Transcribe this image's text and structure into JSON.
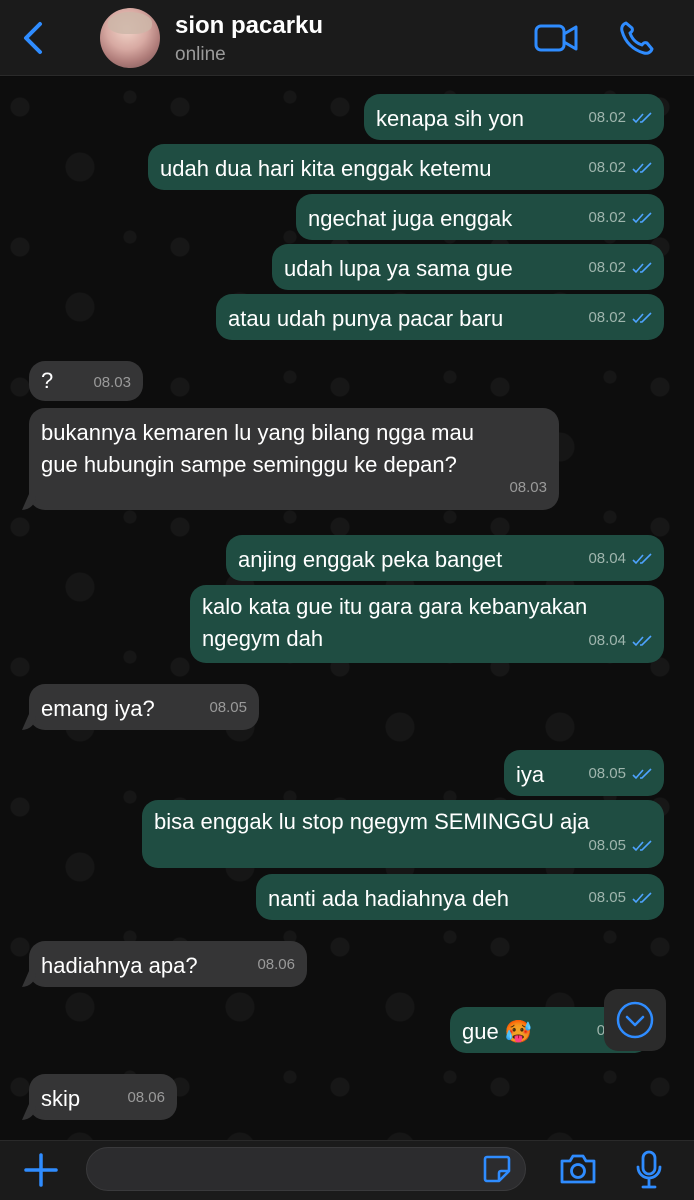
{
  "header": {
    "contact_name": "sion pacarku",
    "status": "online",
    "icons": [
      "chevron-left-icon",
      "video-camera-icon",
      "phone-icon"
    ]
  },
  "messages": [
    {
      "dir": "out",
      "text": "kenapa sih yon",
      "time": "08.02"
    },
    {
      "dir": "out",
      "text": "udah dua hari kita enggak ketemu",
      "time": "08.02"
    },
    {
      "dir": "out",
      "text": "ngechat juga enggak",
      "time": "08.02"
    },
    {
      "dir": "out",
      "text": "udah lupa ya sama gue",
      "time": "08.02"
    },
    {
      "dir": "out",
      "text": "atau udah punya pacar baru",
      "time": "08.02"
    },
    {
      "dir": "in",
      "text": "?",
      "time": "08.03"
    },
    {
      "dir": "in",
      "text_line1": "bukannya kemaren lu yang bilang ngga mau",
      "text_line2": "gue hubungin sampe seminggu ke depan?",
      "time": "08.03"
    },
    {
      "dir": "out",
      "text": "anjing enggak peka banget",
      "time": "08.04"
    },
    {
      "dir": "out",
      "text_line1": "kalo kata gue itu gara gara kebanyakan",
      "text_line2": "ngegym dah",
      "time": "08.04"
    },
    {
      "dir": "in",
      "text": "emang iya?",
      "time": "08.05"
    },
    {
      "dir": "out",
      "text": "iya",
      "time": "08.05"
    },
    {
      "dir": "out",
      "text": "bisa enggak lu stop ngegym SEMINGGU aja",
      "time": "08.05"
    },
    {
      "dir": "out",
      "text": "nanti ada hadiahnya deh",
      "time": "08.05"
    },
    {
      "dir": "in",
      "text": "hadiahnya apa?",
      "time": "08.06"
    },
    {
      "dir": "out",
      "text": "gue 🥵",
      "time": "08.0"
    },
    {
      "dir": "in",
      "text": "skip",
      "time": "08.06"
    }
  ],
  "composer": {
    "input_value": "",
    "icons": [
      "plus-icon",
      "sticker-icon",
      "camera-icon",
      "microphone-icon"
    ]
  },
  "colors": {
    "outgoing_bubble": "#1f4d42",
    "incoming_bubble": "#353536",
    "accent": "#2f8cff",
    "read_ticks": "#4ea3ff"
  }
}
